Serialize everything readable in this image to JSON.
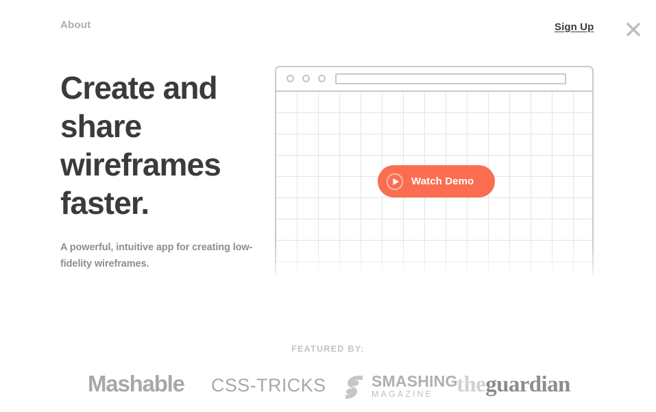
{
  "header": {
    "about_label": "About",
    "signup_label": "Sign Up",
    "close_icon": "close-icon"
  },
  "hero": {
    "headline": "Create and share wireframes faster.",
    "subheadline": "A powerful, intuitive app for creating low-fidelity wireframes."
  },
  "mockup": {
    "dots": [
      "",
      "",
      ""
    ],
    "url_value": "",
    "watch_demo_label": "Watch Demo",
    "play_icon": "play-icon"
  },
  "featured": {
    "label": "FEATURED BY:",
    "logos": [
      {
        "name": "Mashable"
      },
      {
        "name": "CSS-TRICKS"
      },
      {
        "name": "SMASHING",
        "sub": "MAGAZINE"
      },
      {
        "prefix": "the",
        "name": "guardian"
      }
    ]
  },
  "colors": {
    "accent": "#fb6d50",
    "heading": "#3b3b3b",
    "muted": "#8e8e8e",
    "light": "#c3c3c3"
  }
}
